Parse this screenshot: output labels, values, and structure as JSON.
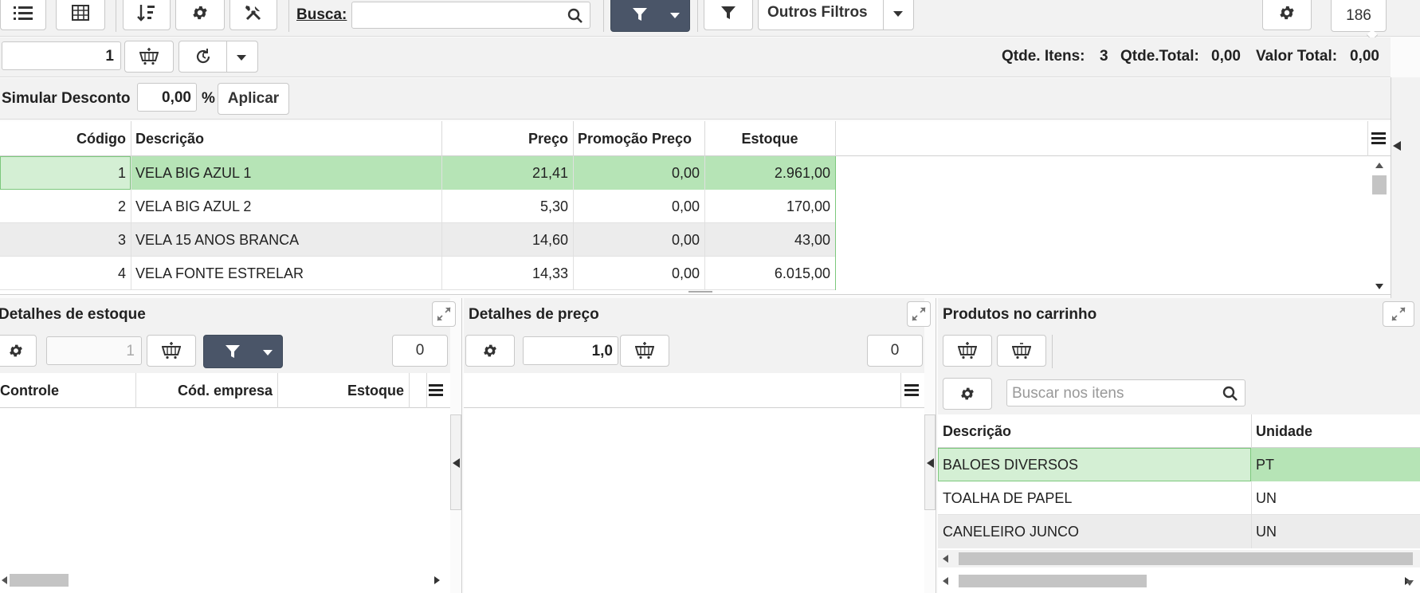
{
  "toolbar": {
    "search_label": "Busca:",
    "search_value": "",
    "other_filters_label": "Outros Filtros",
    "count_badge": "186"
  },
  "qty_bar": {
    "quantity_value": "1",
    "items_label": "Qtde. Itens:",
    "items_value": "3",
    "total_qty_label": "Qtde.Total:",
    "total_qty_value": "0,00",
    "total_value_label": "Valor Total:",
    "total_value_value": "0,00"
  },
  "discount": {
    "label": "Simular Desconto",
    "value": "0,00",
    "percent_sign": "%",
    "apply_label": "Aplicar"
  },
  "products_table": {
    "columns": [
      "Código",
      "Descrição",
      "Preço",
      "Promoção Preço",
      "Estoque"
    ],
    "rows": [
      {
        "codigo": "1",
        "descricao": "VELA BIG AZUL 1",
        "preco": "21,41",
        "promocao": "0,00",
        "estoque": "2.961,00"
      },
      {
        "codigo": "2",
        "descricao": "VELA BIG AZUL 2",
        "preco": "5,30",
        "promocao": "0,00",
        "estoque": "170,00"
      },
      {
        "codigo": "3",
        "descricao": "VELA 15 ANOS BRANCA",
        "preco": "14,60",
        "promocao": "0,00",
        "estoque": "43,00"
      },
      {
        "codigo": "4",
        "descricao": "VELA FONTE ESTRELAR",
        "preco": "14,33",
        "promocao": "0,00",
        "estoque": "6.015,00"
      }
    ]
  },
  "stock_panel": {
    "title": "Detalhes de estoque",
    "qty_value": "1",
    "count_badge": "0",
    "columns": [
      "Controle",
      "Cód. empresa",
      "Estoque"
    ]
  },
  "price_panel": {
    "title": "Detalhes de preço",
    "qty_value": "1,0",
    "count_badge": "0"
  },
  "cart_panel": {
    "title": "Produtos no carrinho",
    "search_placeholder": "Buscar nos itens",
    "columns": [
      "Descrição",
      "Unidade"
    ],
    "rows": [
      {
        "descricao": "BALOES DIVERSOS",
        "unidade": "PT"
      },
      {
        "descricao": "TOALHA DE PAPEL",
        "unidade": "UN"
      },
      {
        "descricao": "CANELEIRO JUNCO",
        "unidade": "UN"
      }
    ]
  },
  "colors": {
    "selected_row": "#b6e4b6",
    "selected_row_light": "#d4efd4",
    "dark_button": "#4a5568",
    "alt_row": "#ececec",
    "toolbar_bg": "#f2f2f2"
  }
}
